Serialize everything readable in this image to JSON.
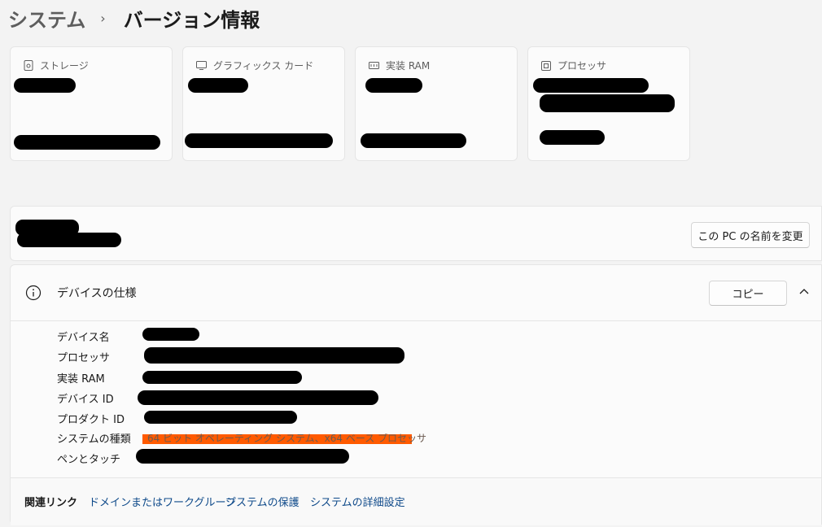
{
  "breadcrumb": {
    "parent": "システム",
    "separator": "›",
    "current": "バージョン情報"
  },
  "cards": [
    {
      "title": "ストレージ",
      "icon": "storage-icon"
    },
    {
      "title": "グラフィックス カード",
      "icon": "graphics-card-icon"
    },
    {
      "title": "実装 RAM",
      "icon": "ram-icon"
    },
    {
      "title": "プロセッサ",
      "icon": "processor-icon"
    }
  ],
  "device_bar": {
    "rename_button": "この PC の名前を変更"
  },
  "specs": {
    "title": "デバイスの仕様",
    "copy_button": "コピー",
    "labels": {
      "device_name": "デバイス名",
      "processor": "プロセッサ",
      "ram": "実装 RAM",
      "device_id": "デバイス ID",
      "product_id": "プロダクト ID",
      "system_type": "システムの種類",
      "pen_touch": "ペンとタッチ"
    },
    "system_type_value": "64 ビット オペレーティング システム、x64 ベース プロセッサ"
  },
  "related": {
    "label": "関連リンク",
    "links": [
      "ドメインまたはワークグループ",
      "システムの保護",
      "システムの詳細設定"
    ]
  },
  "colors": {
    "background": "#f3f3f3",
    "card": "#fbfbfb",
    "link": "#0f4a8a",
    "highlight": "#ff5a00",
    "redaction": "#000000"
  }
}
